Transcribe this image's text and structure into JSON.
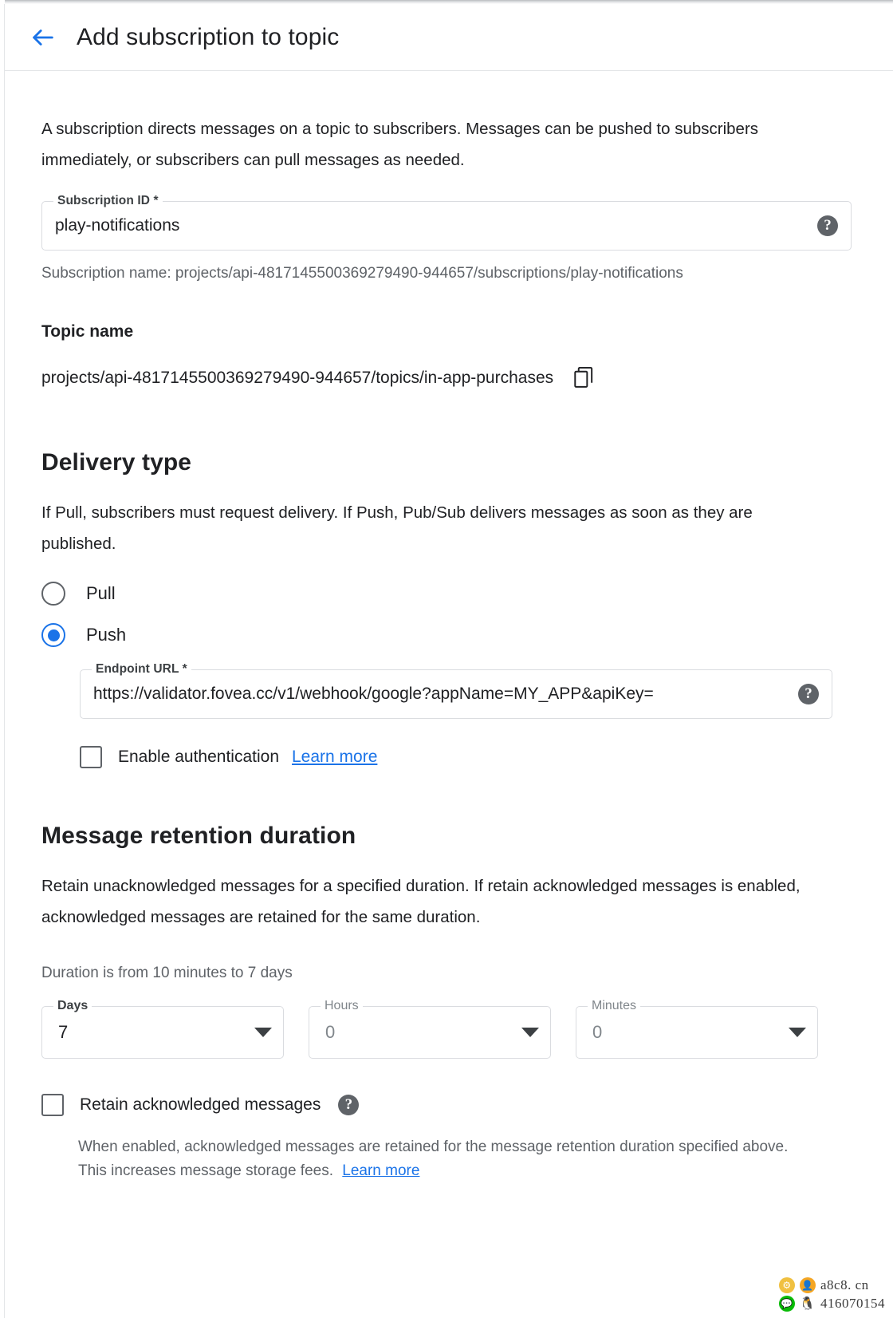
{
  "header": {
    "back_icon": "arrow-left-icon",
    "title": "Add subscription to topic"
  },
  "intro": "A subscription directs messages on a topic to subscribers. Messages can be pushed to subscribers immediately, or subscribers can pull messages as needed.",
  "subscription_id": {
    "label": "Subscription ID *",
    "value": "play-notifications",
    "help_icon": "help-icon",
    "hint": "Subscription name: projects/api-4817145500369279490-944657/subscriptions/play-notifications"
  },
  "topic": {
    "heading": "Topic name",
    "value": "projects/api-4817145500369279490-944657/topics/in-app-purchases",
    "copy_icon": "copy-icon"
  },
  "delivery_type": {
    "heading": "Delivery type",
    "description": "If Pull, subscribers must request delivery. If Push, Pub/Sub delivers messages as soon as they are published.",
    "options": [
      {
        "label": "Pull",
        "selected": false
      },
      {
        "label": "Push",
        "selected": true
      }
    ],
    "endpoint": {
      "label": "Endpoint URL *",
      "value": "https://validator.fovea.cc/v1/webhook/google?appName=MY_APP&apiKey=",
      "help_icon": "help-icon"
    },
    "enable_auth": {
      "label": "Enable authentication",
      "checked": false,
      "link": "Learn more"
    }
  },
  "retention": {
    "heading": "Message retention duration",
    "description": "Retain unacknowledged messages for a specified duration. If retain acknowledged messages is enabled, acknowledged messages are retained for the same duration.",
    "range_note": "Duration is from 10 minutes to 7 days",
    "selects": [
      {
        "label": "Days",
        "value": "7",
        "active": true
      },
      {
        "label": "Hours",
        "value": "0",
        "active": false
      },
      {
        "label": "Minutes",
        "value": "0",
        "active": false
      }
    ],
    "retain_ack": {
      "label": "Retain acknowledged messages",
      "checked": false,
      "help_icon": "help-icon"
    },
    "foot_note": "When enabled, acknowledged messages are retained for the message retention duration specified above. This increases message storage fees.",
    "foot_link": "Learn more"
  },
  "watermark": {
    "line1": "a8c8. cn",
    "line2": "416070154"
  },
  "colors": {
    "accent": "#1a73e8",
    "text": "#202124",
    "muted": "#5f6368",
    "border": "#dadce0"
  }
}
